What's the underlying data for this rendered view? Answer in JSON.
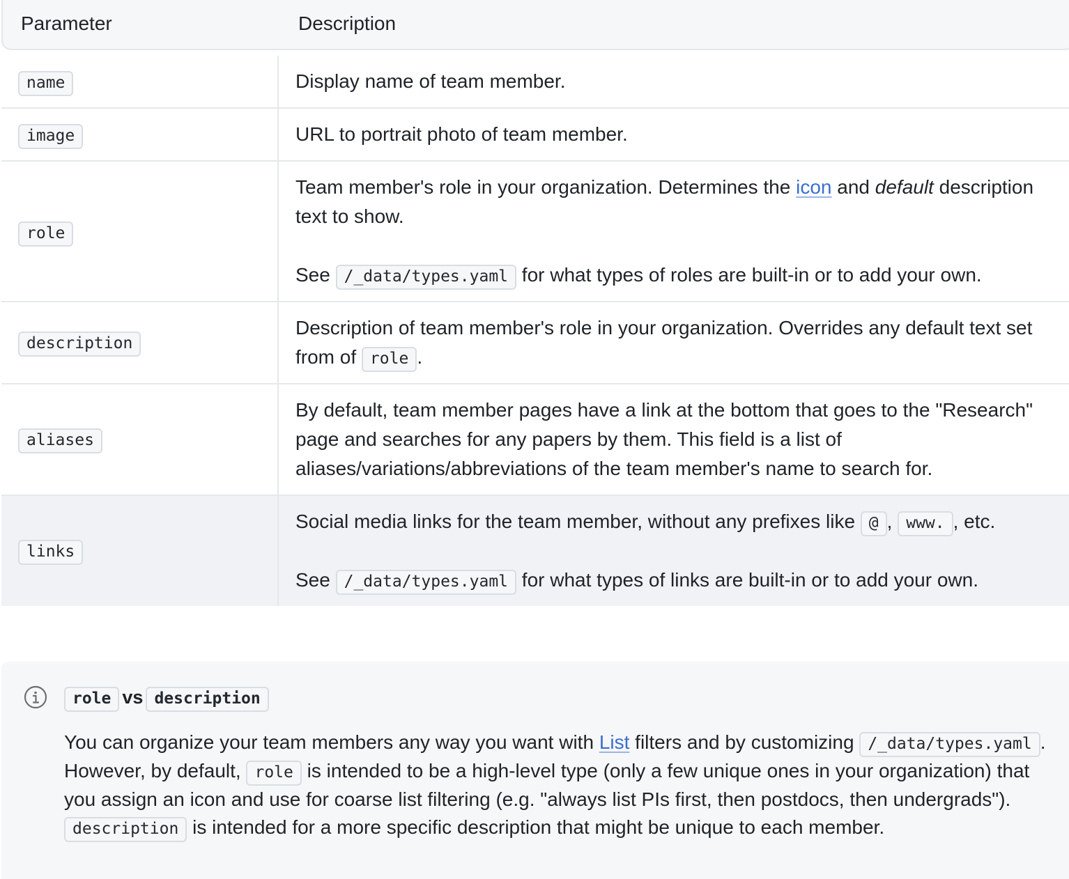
{
  "table": {
    "headers": {
      "parameter": "Parameter",
      "description": "Description"
    },
    "rows": {
      "name": {
        "param": "name",
        "desc": "Display name of team member."
      },
      "image": {
        "param": "image",
        "desc": "URL to portrait photo of team member."
      },
      "role": {
        "param": "role",
        "p1_a": "Team member's role in your organization. Determines the ",
        "p1_link": "icon",
        "p1_b": " and ",
        "p1_em": "default",
        "p1_c": " description text to show.",
        "p2_a": "See ",
        "p2_code": "/_data/types.yaml",
        "p2_b": " for what types of roles are built-in or to add your own."
      },
      "description": {
        "param": "description",
        "a": "Description of team member's role in your organization. Overrides any default text set from of ",
        "code": "role",
        "b": "."
      },
      "aliases": {
        "param": "aliases",
        "desc": "By default, team member pages have a link at the bottom that goes to the \"Research\" page and searches for any papers by them. This field is a list of aliases/variations/abbreviations of the team member's name to search for."
      },
      "links": {
        "param": "links",
        "p1_a": "Social media links for the team member, without any prefixes like ",
        "p1_code1": "@",
        "p1_sep": ", ",
        "p1_code2": "www.",
        "p1_b": ", etc.",
        "p2_a": "See ",
        "p2_code": "/_data/types.yaml",
        "p2_b": " for what types of links are built-in or to add your own."
      }
    }
  },
  "callout": {
    "icon": "info-icon",
    "title_code1": "role",
    "title_vs": "vs",
    "title_code2": "description",
    "b1": "You can organize your team members any way you want with ",
    "link": "List",
    "b2": " filters and by customizing ",
    "code1": "/_data/types.yaml",
    "b3": ". However, by default, ",
    "code2": "role",
    "b4": " is intended to be a high-level type (only a few unique ones in your organization) that you assign an icon and use for coarse list filtering (e.g. \"always list PIs first, then postdocs, then undergrads\"). ",
    "code3": "description",
    "b5": " is intended for a more specific description that might be unique to each member."
  }
}
